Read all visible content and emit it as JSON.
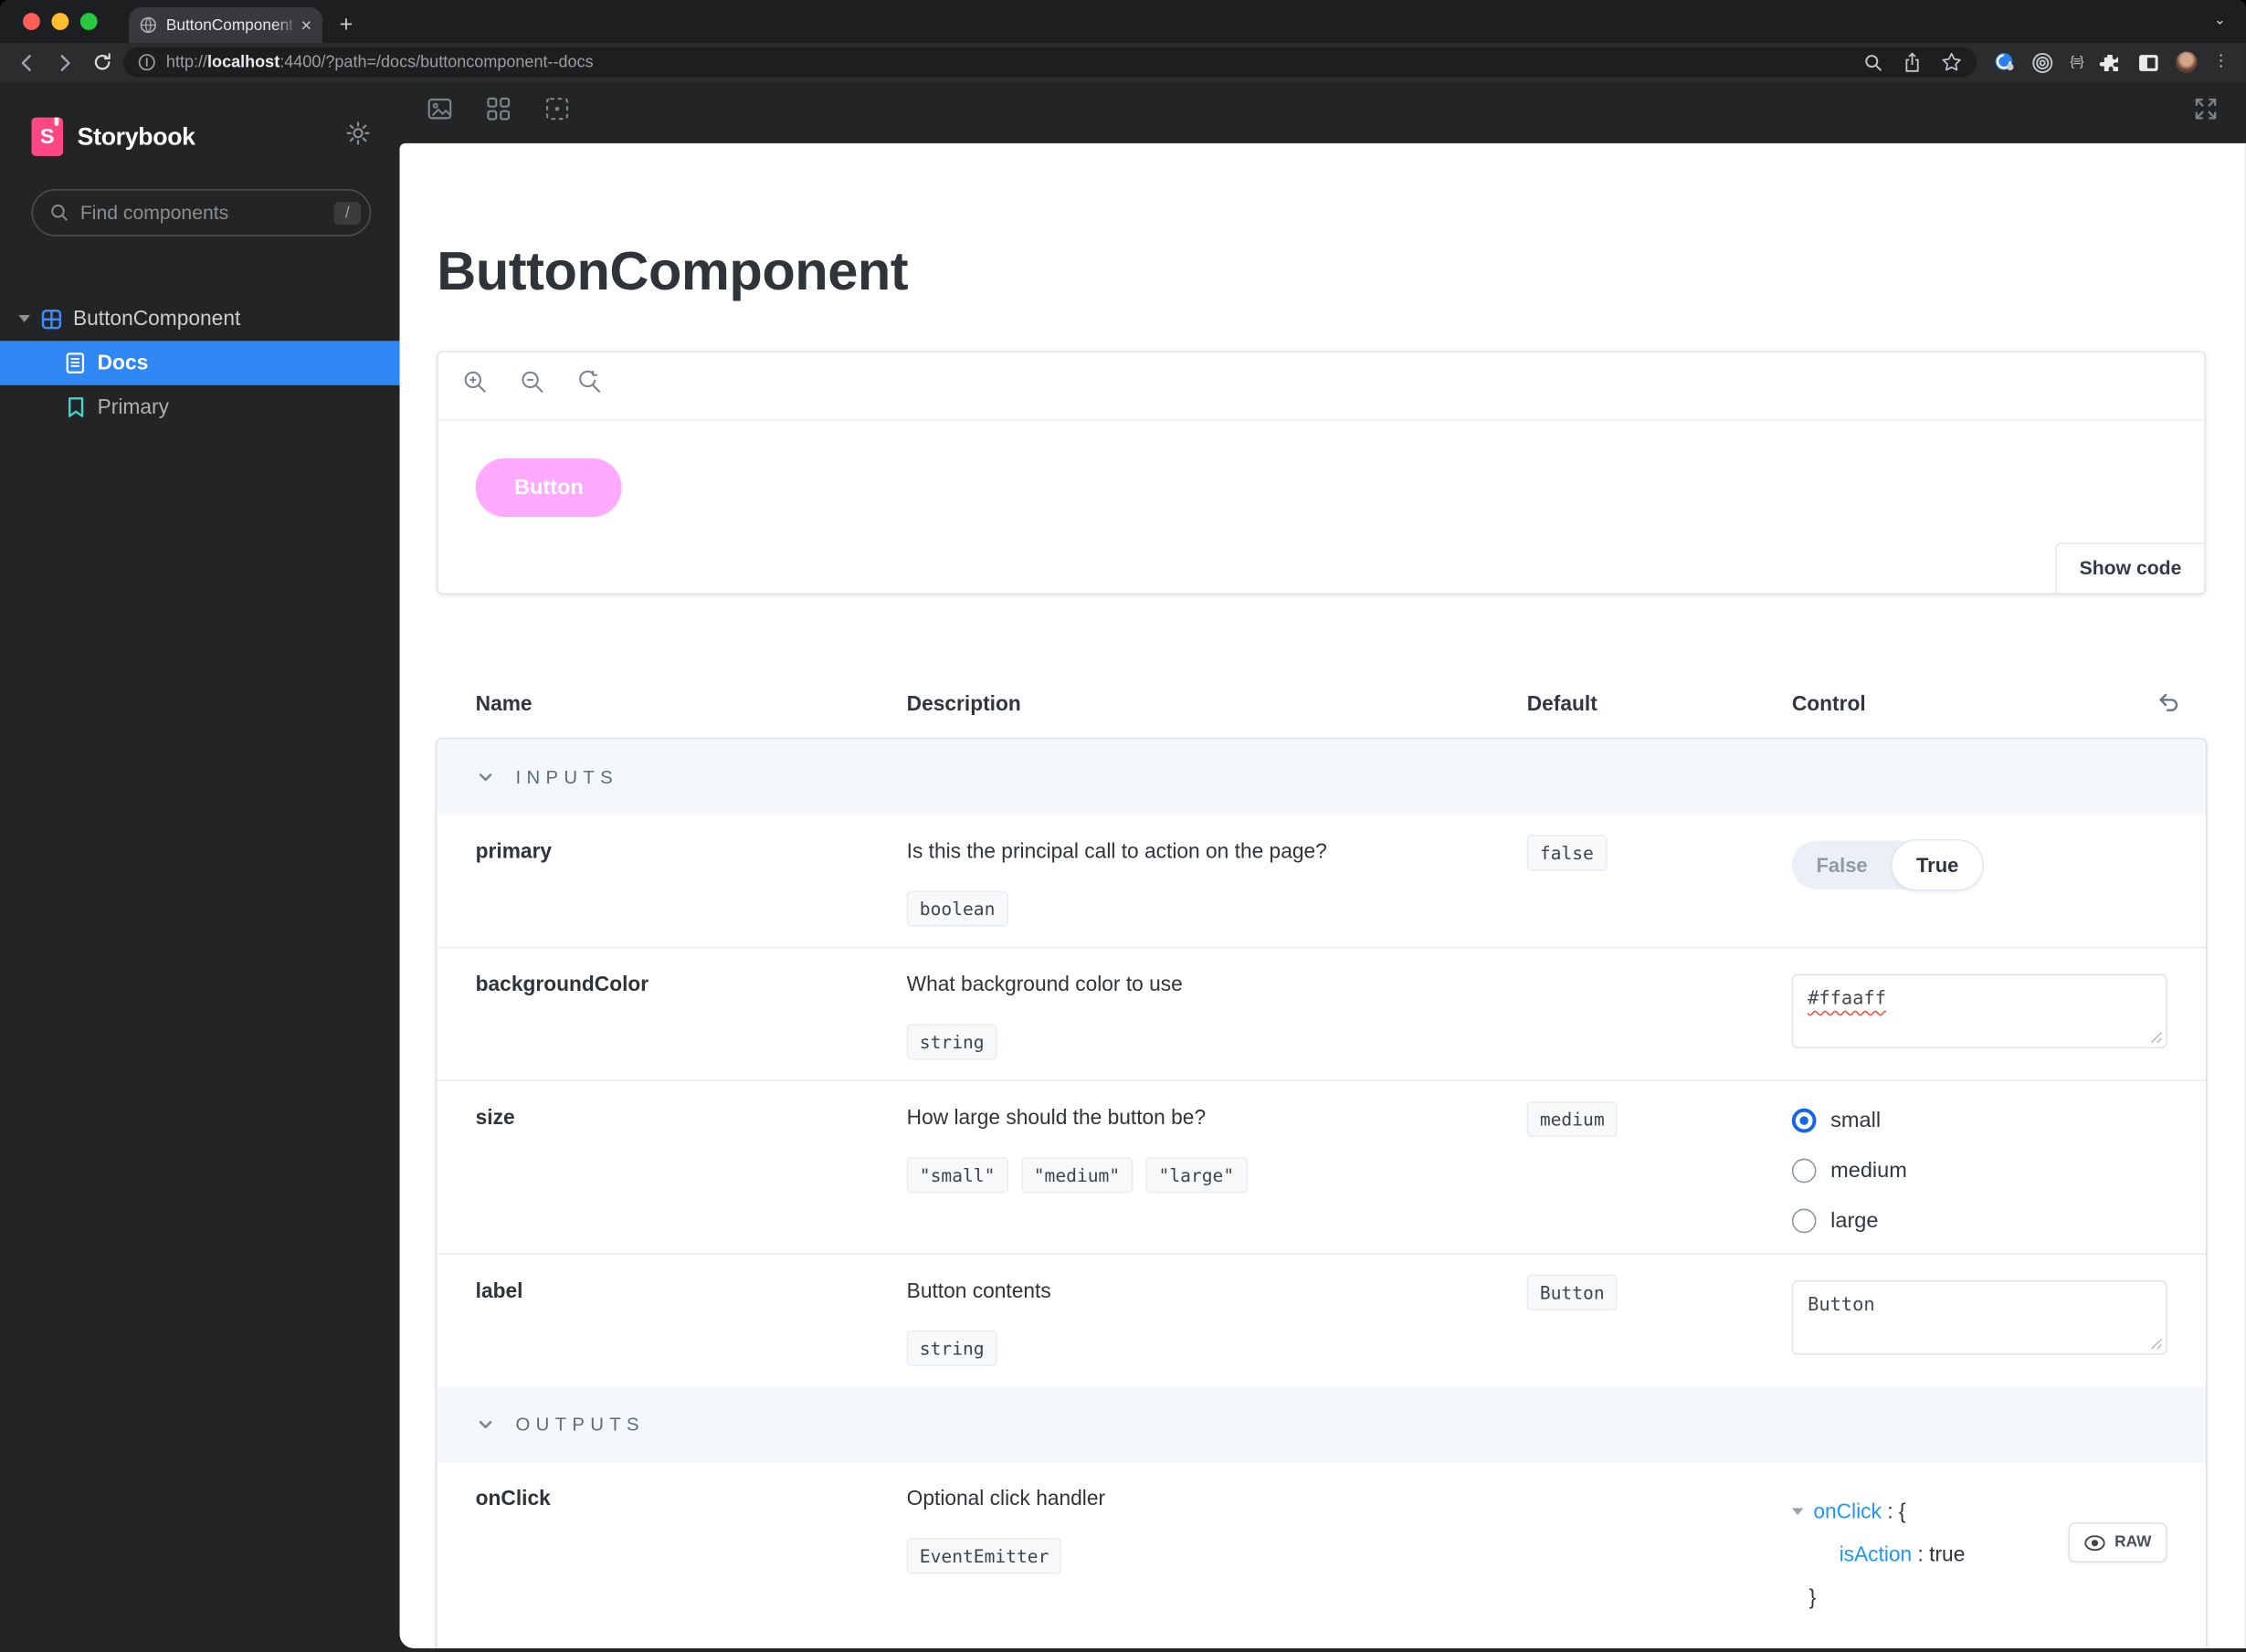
{
  "colors": {
    "brand_pink": "#ff4785",
    "selection_blue": "#2f87f3",
    "object_link_blue": "#2196f3",
    "button_bg": "#ffaaff"
  },
  "browser": {
    "tab_title": "ButtonComponent - Docs · St",
    "close_glyph": "×",
    "new_tab_glyph": "+",
    "tab_chevron": "⌄",
    "url_prefix": "http://",
    "url_host": "localhost",
    "url_rest": ":4400/?path=/docs/buttoncomponent--docs",
    "ext_braces_label": "{≡}",
    "kebab_glyph": "⋮"
  },
  "sidebar": {
    "brand": "Storybook",
    "logo_letter": "S",
    "search": {
      "placeholder": "Find components",
      "shortcut": "/"
    },
    "tree": [
      {
        "label": "ButtonComponent"
      },
      {
        "label": "Docs"
      },
      {
        "label": "Primary"
      }
    ]
  },
  "docs": {
    "title": "ButtonComponent",
    "preview": {
      "button_label": "Button",
      "button_color": "#ffaaff",
      "show_code_label": "Show code"
    },
    "table": {
      "headers": [
        "Name",
        "Description",
        "Default",
        "Control"
      ],
      "sections": [
        {
          "label": "INPUTS",
          "rows": [
            {
              "name": "primary",
              "description": "Is this the principal call to action on the page?",
              "type_chips": [
                "boolean"
              ],
              "default_chip": "false",
              "control": {
                "type": "toggle",
                "off": "False",
                "on": "True",
                "selected": "True"
              }
            },
            {
              "name": "backgroundColor",
              "description": "What background color to use",
              "type_chips": [
                "string"
              ],
              "default_chip": null,
              "control": {
                "type": "text",
                "value": "#ffaaff",
                "misspelled": true
              }
            },
            {
              "name": "size",
              "description": "How large should the button be?",
              "type_chips": [
                "\"small\"",
                "\"medium\"",
                "\"large\""
              ],
              "default_chip": "medium",
              "control": {
                "type": "radio",
                "options": [
                  "small",
                  "medium",
                  "large"
                ],
                "selected": "small"
              }
            },
            {
              "name": "label",
              "description": "Button contents",
              "type_chips": [
                "string"
              ],
              "default_chip": "Button",
              "control": {
                "type": "text",
                "value": "Button",
                "misspelled": false
              }
            }
          ]
        },
        {
          "label": "OUTPUTS",
          "rows": [
            {
              "name": "onClick",
              "description": "Optional click handler",
              "type_chips": [
                "EventEmitter"
              ],
              "default_chip": null,
              "control": {
                "type": "object",
                "key": "onClick",
                "open": "{",
                "prop_key": "isAction",
                "prop_value": "true",
                "close": "}",
                "raw_label": "RAW"
              }
            }
          ]
        }
      ]
    }
  }
}
